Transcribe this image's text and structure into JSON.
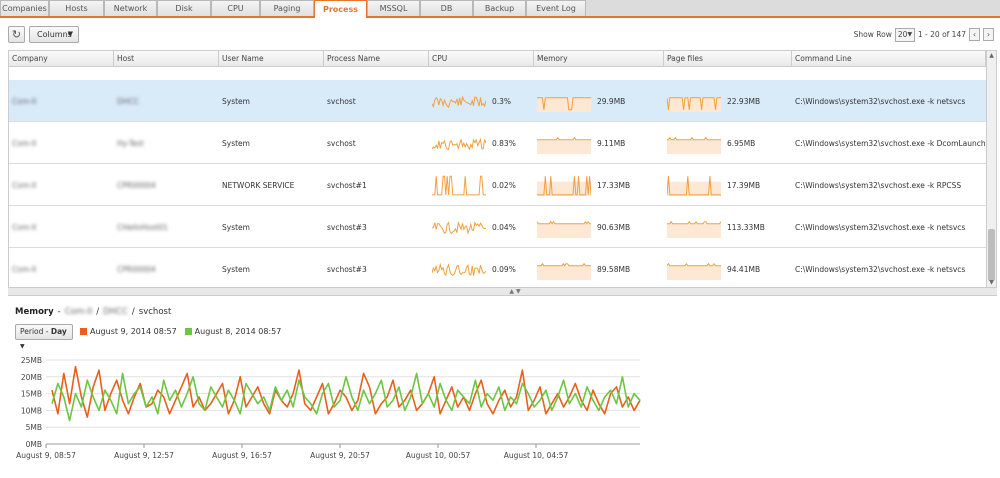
{
  "tabs": [
    "Companies",
    "Hosts",
    "Network",
    "Disk",
    "CPU",
    "Paging",
    "Process",
    "MSSQL",
    "DB",
    "Backup",
    "Event Log"
  ],
  "active_tab": "Process",
  "toolbar": {
    "columns_label": "Columns",
    "show_row_label": "Show Row",
    "show_row_value": "20",
    "page_range": "1 - 20 of 147"
  },
  "columns": [
    "Company",
    "Host",
    "User Name",
    "Process Name",
    "CPU",
    "Memory",
    "Page files",
    "Command Line"
  ],
  "rows": [
    {
      "company": "Com-II",
      "host": "DHCC",
      "user": "System",
      "process": "svchost",
      "cpu": "0.3%",
      "memory": "29.9MB",
      "pagefiles": "22.93MB",
      "cmd": "C:\\Windows\\system32\\svchost.exe -k netsvcs",
      "selected": true
    },
    {
      "company": "Com-II",
      "host": "Hy-Test",
      "user": "System",
      "process": "svchost",
      "cpu": "0.83%",
      "memory": "9.11MB",
      "pagefiles": "6.95MB",
      "cmd": "C:\\Windows\\system32\\svchost.exe -k DcomLaunch",
      "selected": false
    },
    {
      "company": "Com-II",
      "host": "CPR00004",
      "user": "NETWORK SERVICE",
      "process": "svchost#1",
      "cpu": "0.02%",
      "memory": "17.33MB",
      "pagefiles": "17.39MB",
      "cmd": "C:\\Windows\\system32\\svchost.exe -k RPCSS",
      "selected": false
    },
    {
      "company": "Com-II",
      "host": "CHelloHost01",
      "user": "System",
      "process": "svchost#3",
      "cpu": "0.04%",
      "memory": "90.63MB",
      "pagefiles": "113.33MB",
      "cmd": "C:\\Windows\\system32\\svchost.exe -k netsvcs",
      "selected": false
    },
    {
      "company": "Com-II",
      "host": "CPR00004",
      "user": "System",
      "process": "svchost#3",
      "cpu": "0.09%",
      "memory": "89.58MB",
      "pagefiles": "94.41MB",
      "cmd": "C:\\Windows\\system32\\svchost.exe -k netsvcs",
      "selected": false
    }
  ],
  "detail": {
    "title": "Memory",
    "company": "Com-II",
    "host": "DHCC",
    "process": "svchost",
    "separator": "/",
    "period_label": "Period - ",
    "period_value": "Day",
    "legend": [
      {
        "label": "August 9, 2014 08:57",
        "color": "#e8601c"
      },
      {
        "label": "August 8, 2014 08:57",
        "color": "#6cc644"
      }
    ]
  },
  "colors": {
    "accent": "#e8742c",
    "spark": "#f0a040",
    "spark_fill": "#fce8d4",
    "selected_row": "#d9eaf9"
  },
  "chart_data": {
    "type": "line",
    "ylabel_ticks": [
      "0MB",
      "5MB",
      "10MB",
      "15MB",
      "20MB",
      "25MB"
    ],
    "ylim": [
      0,
      25
    ],
    "x_tick_labels": [
      "August 9, 08:57",
      "August 9, 12:57",
      "August 9, 16:57",
      "August 9, 20:57",
      "August 10, 00:57",
      "August 10, 04:57"
    ],
    "grid": "horizontal",
    "series": [
      {
        "name": "August 9, 2014 08:57",
        "color": "#e8601c",
        "values": [
          16,
          9,
          21,
          12,
          23,
          14,
          8,
          17,
          22,
          10,
          15,
          19,
          13,
          9,
          14,
          18,
          11,
          12,
          16,
          14,
          9,
          13,
          17,
          21,
          11,
          14,
          10,
          12,
          15,
          18,
          9,
          13,
          20,
          11,
          14,
          17,
          12,
          9,
          16,
          13,
          11,
          15,
          22,
          12,
          10,
          14,
          18,
          9,
          12,
          16,
          14,
          10,
          13,
          21,
          17,
          9,
          12,
          14,
          19,
          11,
          13,
          16,
          10,
          12,
          15,
          20,
          9,
          13,
          17,
          11,
          14,
          10,
          15,
          19,
          12,
          9,
          13,
          16,
          11,
          14,
          22,
          10,
          13,
          17,
          9,
          12,
          15,
          11,
          14,
          18,
          13,
          10,
          16,
          12,
          9,
          15,
          17,
          11,
          14,
          10,
          13
        ]
      },
      {
        "name": "August 8, 2014 08:57",
        "color": "#6cc644",
        "values": [
          12,
          18,
          14,
          7,
          15,
          11,
          19,
          14,
          10,
          16,
          13,
          9,
          21,
          12,
          15,
          17,
          11,
          14,
          9,
          19,
          13,
          16,
          11,
          15,
          20,
          12,
          10,
          17,
          14,
          11,
          16,
          13,
          9,
          18,
          15,
          12,
          14,
          10,
          17,
          13,
          16,
          11,
          19,
          14,
          12,
          9,
          15,
          18,
          11,
          13,
          20,
          14,
          10,
          16,
          12,
          15,
          19,
          11,
          13,
          17,
          10,
          14,
          21,
          12,
          15,
          11,
          18,
          13,
          10,
          16,
          14,
          12,
          19,
          11,
          15,
          13,
          17,
          10,
          14,
          12,
          18,
          15,
          11,
          13,
          16,
          10,
          14,
          19,
          12,
          15,
          11,
          17,
          13,
          10,
          14,
          16,
          12,
          20,
          11,
          15,
          13
        ]
      }
    ]
  }
}
